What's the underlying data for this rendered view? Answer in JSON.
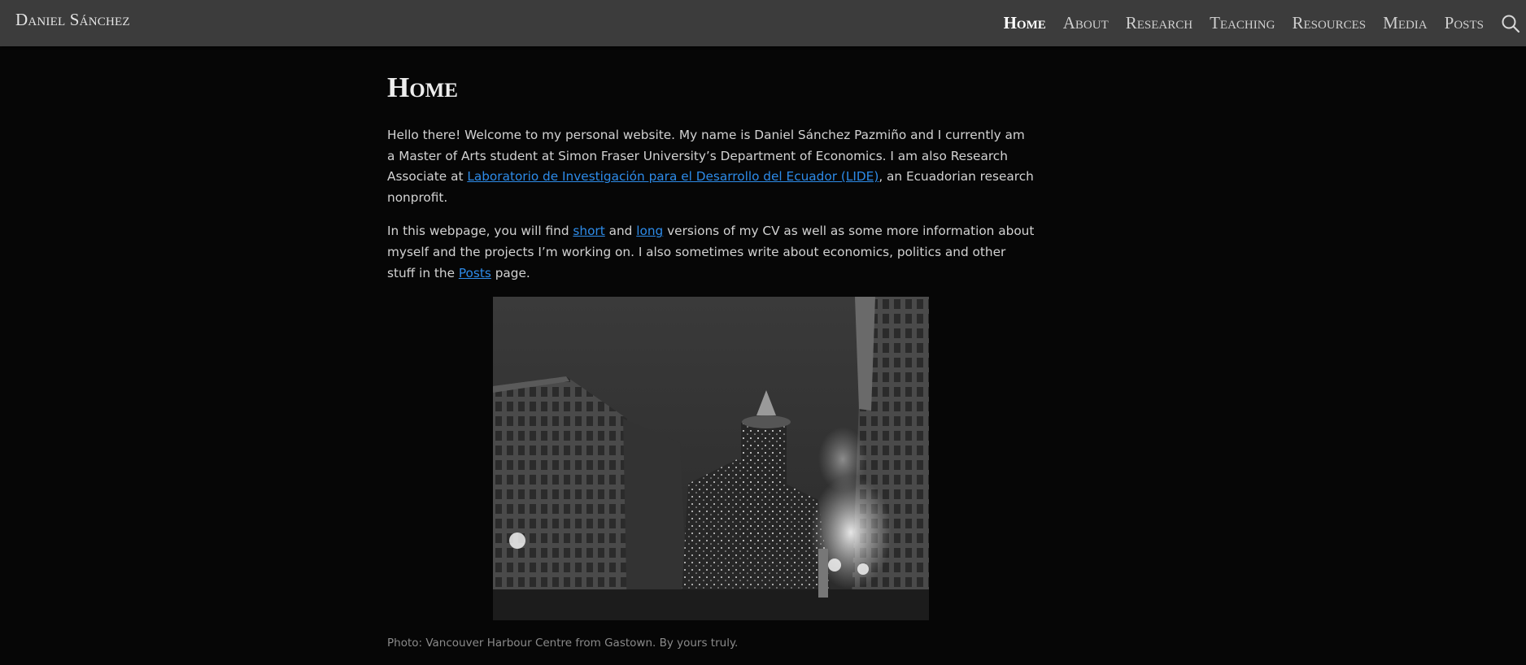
{
  "header": {
    "brand": "Daniel Sánchez",
    "nav": [
      "Home",
      "About",
      "Research",
      "Teaching",
      "Resources",
      "Media",
      "Posts"
    ],
    "active": "Home",
    "search_icon": "search-icon"
  },
  "main": {
    "title": "Home",
    "para1": {
      "before": "Hello there! Welcome to my personal website. My name is Daniel Sánchez Pazmiño and I currently am a Master of Arts student at Simon Fraser University’s Department of Economics. I am also Research Associate at ",
      "link": "Laboratorio de Investigación para el Desarrollo del Ecuador (LIDE)",
      "after": ", an Ecuadorian research nonprofit."
    },
    "para2": {
      "t1": "In this webpage, you will find ",
      "link_short": "short",
      "t2": " and ",
      "link_long": "long",
      "t3": " versions of my CV as well as some more information about myself and the projects I’m working on. I also sometimes write about economics, politics and other stuff in the ",
      "link_posts": "Posts",
      "t4": " page."
    },
    "caption": "Photo: Vancouver Harbour Centre from Gastown. By yours truly."
  },
  "colors": {
    "background": "#060606",
    "topbar": "#3c3c3c",
    "link": "#2d8be8",
    "text": "#d2d2d2",
    "caption": "#8a8a8a"
  }
}
